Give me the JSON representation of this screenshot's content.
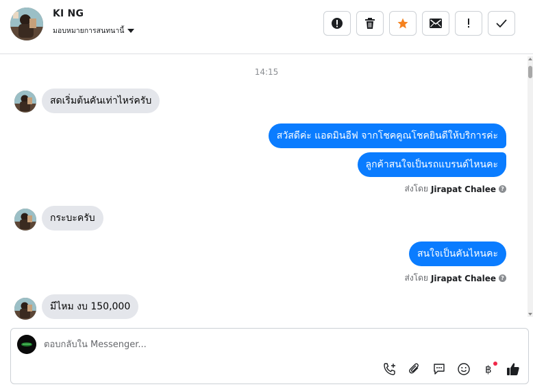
{
  "header": {
    "contact_name": "KI NG",
    "assign_label": "มอบหมายการสนทนานี้",
    "actions": [
      {
        "name": "spam-button",
        "icon": "exclamation-circle-icon"
      },
      {
        "name": "delete-button",
        "icon": "trash-icon"
      },
      {
        "name": "star-button",
        "icon": "star-icon",
        "color": "#f5821f"
      },
      {
        "name": "mark-unread-button",
        "icon": "envelope-icon"
      },
      {
        "name": "follow-up-button",
        "icon": "exclamation-icon"
      },
      {
        "name": "done-button",
        "icon": "check-icon"
      }
    ]
  },
  "chat": {
    "timestamp": "14:15",
    "messages": {
      "in1": "สดเริ่มต้นคันเท่าไหร่ครับ",
      "out1": "สวัสดีค่ะ แอดมินอีฟ จากโชคคูณโชคยินดีให้บริการค่ะ",
      "out2": "ลูกค้าสนใจเป็นรถแบรนด์ไหนคะ",
      "in2": "กระบะครับ",
      "out3": "สนใจเป็นคันไหนคะ",
      "in3": "มีไหม งบ 150,000"
    },
    "sent_by_prefix": "ส่งโดย",
    "sent_by_name": "Jirapat Chalee"
  },
  "composer": {
    "placeholder": "ตอบกลับใน Messenger...",
    "value": ""
  },
  "colors": {
    "outgoing_bubble": "#0a7cff",
    "incoming_bubble": "#e4e6eb",
    "star": "#f5821f",
    "notification_dot": "#f02849"
  }
}
